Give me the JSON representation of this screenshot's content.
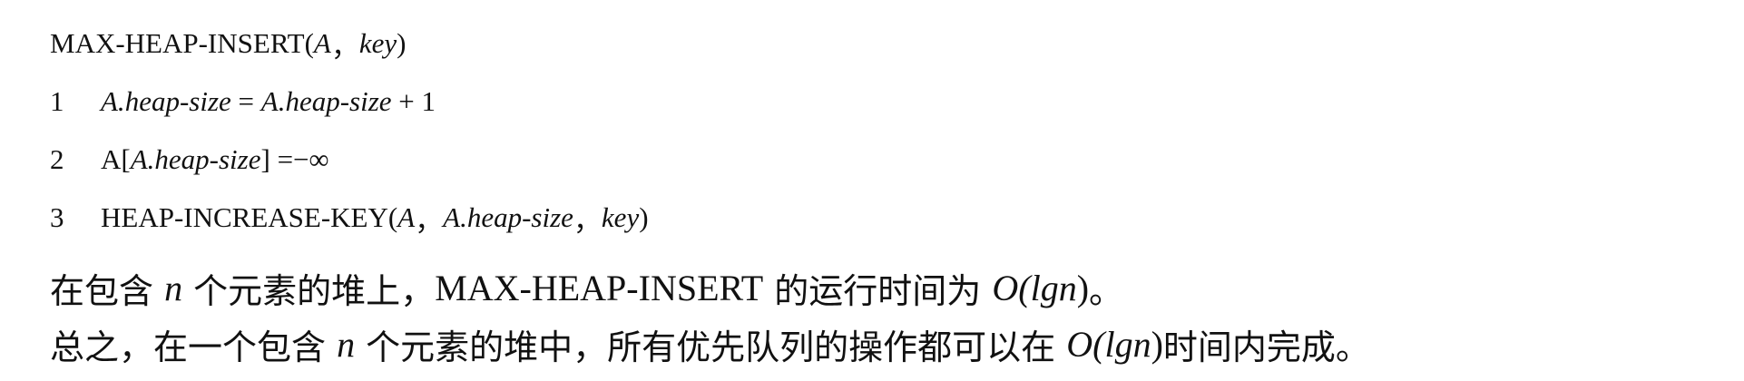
{
  "algorithm": {
    "header": {
      "name": "MAX-HEAP-INSERT",
      "open": "(",
      "arg1": "A",
      "sep": "，",
      "arg2": "key",
      "close": ")"
    },
    "lines": [
      {
        "num": "1",
        "a": "A.",
        "b": "heap-size",
        "op": " = ",
        "c": "A.",
        "d": "heap-size",
        "tail": " + 1"
      },
      {
        "num": "2",
        "a": "A[",
        "b": "A.",
        "c": "heap-size",
        "d": "] =−∞"
      },
      {
        "num": "3",
        "call": "HEAP-INCREASE-KEY(",
        "arg1": "A",
        "sep1": "，",
        "arg2a": "A.",
        "arg2b": "heap-size",
        "sep2": "，",
        "arg3": "key",
        "close": ")"
      }
    ]
  },
  "paragraphs": [
    {
      "p1": "在包含 ",
      "n": "n",
      "p2": " 个元素的堆上，",
      "latin": "MAX-HEAP-INSERT",
      "p3": " 的运行时间为 ",
      "bigO": "O(lg",
      "n2": "n",
      "close": ")",
      "end": "。"
    },
    {
      "p1": "总之，在一个包含 ",
      "n": "n",
      "p2": " 个元素的堆中，所有优先队列的操作都可以在 ",
      "bigO": "O(lg",
      "n2": "n",
      "close": ")",
      "end": "时间内完成。"
    }
  ]
}
